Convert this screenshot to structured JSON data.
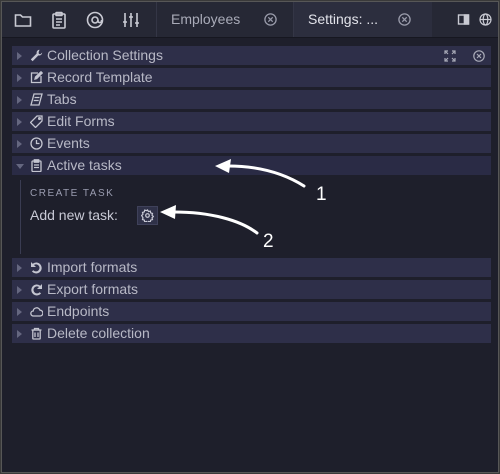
{
  "tabs": [
    {
      "label": "Employees",
      "active": false
    },
    {
      "label": "Settings: ...",
      "active": true
    }
  ],
  "toolbar": {
    "icons": [
      "folder-icon",
      "clipboard-icon",
      "at-sign-icon",
      "sliders-icon"
    ],
    "right_icons": [
      "panel-toggle-icon",
      "globe-icon"
    ]
  },
  "settings": {
    "sections": [
      {
        "label": "Collection Settings",
        "icon": "wrench-icon"
      },
      {
        "label": "Record Template",
        "icon": "edit-icon"
      },
      {
        "label": "Tabs",
        "icon": "layers-icon"
      },
      {
        "label": "Edit Forms",
        "icon": "tag-icon"
      },
      {
        "label": "Events",
        "icon": "clock-icon"
      },
      {
        "label": "Active tasks",
        "icon": "clipboard-icon",
        "expanded": true
      },
      {
        "label": "Import formats",
        "icon": "undo-icon"
      },
      {
        "label": "Export formats",
        "icon": "redo-icon"
      },
      {
        "label": "Endpoints",
        "icon": "cloud-icon"
      },
      {
        "label": "Delete collection",
        "icon": "trash-icon"
      }
    ],
    "active_tasks": {
      "heading": "CREATE TASK",
      "add_label": "Add new task:",
      "add_button_icon": "gear-icon"
    }
  },
  "annotations": [
    "1",
    "2"
  ],
  "colors": {
    "background": "#1e1f2b",
    "row": "#2e2f49",
    "topbar": "#262835",
    "annotation": "#ffffff"
  }
}
